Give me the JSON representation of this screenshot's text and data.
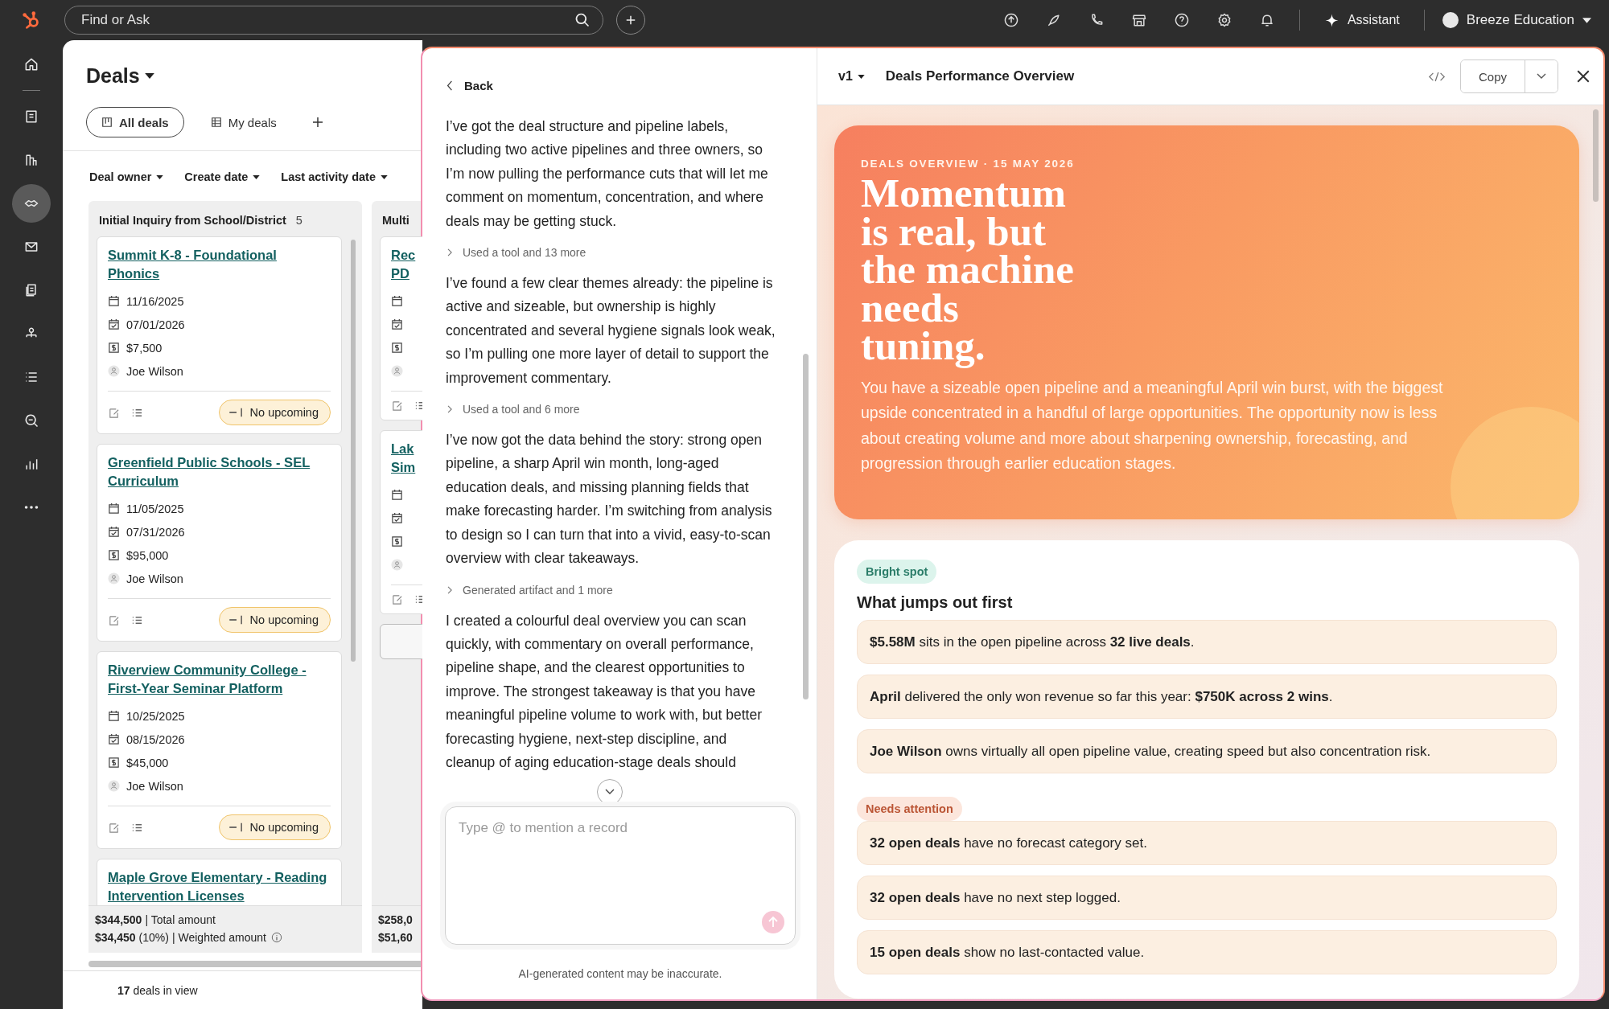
{
  "top_bar": {
    "search": {
      "placeholder": "Find or Ask"
    },
    "assistant": "Assistant",
    "account": "Breeze Education"
  },
  "sidebar": {
    "items": [
      {
        "selected": false
      },
      {
        "selected": false
      },
      {
        "selected": false
      },
      {
        "selected": true
      },
      {
        "selected": false
      },
      {
        "selected": false
      },
      {
        "selected": false
      },
      {
        "selected": false
      },
      {
        "selected": false
      },
      {
        "selected": false
      },
      {
        "selected": false
      }
    ]
  },
  "deals": {
    "title": "Deals",
    "views": [
      {
        "label": "All deals",
        "selected": true
      },
      {
        "label": "My deals",
        "selected": false
      }
    ],
    "filters": [
      "Deal owner",
      "Create date",
      "Last activity date"
    ],
    "columns": [
      {
        "name": "Initial Inquiry from School/District",
        "count": "5",
        "cards": [
          {
            "title": "Summit K-8 - Foundational Phonics",
            "create_date": "11/16/2025",
            "close_date": "07/01/2026",
            "amount": "$7,500",
            "owner": "Joe Wilson",
            "activity": "No upcoming"
          },
          {
            "title": "Greenfield Public Schools - SEL Curriculum",
            "create_date": "11/05/2025",
            "close_date": "07/31/2026",
            "amount": "$95,000",
            "owner": "Joe Wilson",
            "activity": "No upcoming"
          },
          {
            "title": "Riverview Community College - First-Year Seminar Platform",
            "create_date": "10/25/2025",
            "close_date": "08/15/2026",
            "amount": "$45,000",
            "owner": "Joe Wilson",
            "activity": "No upcoming"
          },
          {
            "title": "Maple Grove Elementary - Reading Intervention Licenses"
          }
        ],
        "total_amount": "$344,500",
        "total_label": "| Total amount",
        "weighted_amount": "$34,450",
        "weighted_share": "(10%)",
        "weighted_label": "| Weighted amount"
      },
      {
        "name": "Multi",
        "cards": [
          {
            "title_lines": [
              "Rec",
              "PD"
            ]
          },
          {
            "title_lines": [
              "Lak",
              "Sim"
            ]
          }
        ],
        "total_amount": "$258,0",
        "weighted_amount": "$51,60"
      }
    ],
    "footer": {
      "count": "17",
      "label": "deals in view"
    }
  },
  "chat": {
    "back": "Back",
    "messages": [
      {
        "kind": "text",
        "text": "I’ve got the deal structure and pipeline labels, including two active pipelines and three owners, so I’m now pulling the performance cuts that will let me comment on momentum, concentration, and where deals may be getting stuck."
      },
      {
        "kind": "step",
        "text": "Used a tool and 13 more"
      },
      {
        "kind": "text",
        "text": "I’ve found a few clear themes already: the pipeline is active and sizeable, but ownership is highly concentrated and several hygiene signals look weak, so I’m pulling one more layer of detail to support the improvement commentary."
      },
      {
        "kind": "step",
        "text": "Used a tool and 6 more"
      },
      {
        "kind": "text",
        "text": "I’ve now got the data behind the story: strong open pipeline, a sharp April win month, long-aged education deals, and missing planning fields that make forecasting harder. I’m switching from analysis to design so I can turn that into a vivid, easy-to-scan overview with clear takeaways."
      },
      {
        "kind": "step",
        "text": "Generated artifact and 1 more"
      },
      {
        "kind": "text",
        "text": "I created a colourful deal overview you can scan quickly, with commentary on overall performance, pipeline shape, and the clearest opportunities to improve. The strongest takeaway is that you have meaningful pipeline volume to work with, but better forecasting hygiene, next-step discipline, and cleanup of aging education-stage deals should"
      }
    ],
    "input": {
      "placeholder": "Type @ to mention a record"
    },
    "disclaimer": "AI-generated content may be inaccurate."
  },
  "artifact": {
    "version": "v1",
    "title": "Deals Performance Overview",
    "copy": "Copy",
    "hero": {
      "eyebrow": "DEALS OVERVIEW · 15 MAY 2026",
      "heading_lines": [
        "Momentum",
        "is real, but",
        "the machine",
        "needs",
        "tuning."
      ],
      "summary": "You have a sizeable open pipeline and a meaningful April win burst, with the biggest upside concentrated in a handful of large opportunities. The opportunity now is less about creating volume and more about sharpening ownership, forecasting, and progression through earlier education stages."
    },
    "sections": [
      {
        "kind": "bright",
        "label": "Bright spot",
        "heading": "What jumps out first",
        "items": [
          "**$5.58M** sits in the open pipeline across **32 live deals**.",
          "**April** delivered the only won revenue so far this year: **$750K across 2 wins**.",
          "**Joe Wilson** owns virtually all open pipeline value, creating speed but also concentration risk."
        ]
      },
      {
        "kind": "attention",
        "label": "Needs attention",
        "items": [
          "**32 open deals** have no forecast category set.",
          "**32 open deals** have no next step logged.",
          "**15 open deals** show no last-contacted value."
        ]
      }
    ]
  }
}
